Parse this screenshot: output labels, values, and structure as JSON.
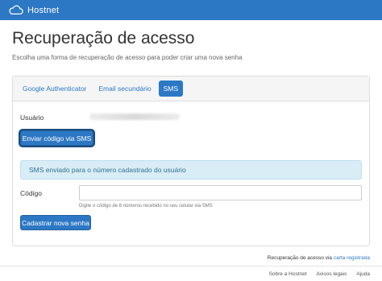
{
  "navbar": {
    "brand": "Hostnet"
  },
  "page": {
    "title": "Recuperação de acesso",
    "subtitle": "Escolha uma forma de recuperação de acesso para poder criar uma nova senha"
  },
  "tabs": [
    {
      "label": "Google Authenticator",
      "active": false
    },
    {
      "label": "Email secundário",
      "active": false
    },
    {
      "label": "SMS",
      "active": true
    }
  ],
  "form": {
    "user_label": "Usuário",
    "send_sms_button": "Enviar código via SMS",
    "alert_text": "SMS enviado para o número cadastrado do usuário",
    "code_label": "Código",
    "code_value": "",
    "code_help": "Digite o código de 6 números recebido no seu celular via SMS",
    "submit_button": "Cadastrar nova senha"
  },
  "recovery_note": {
    "text": "Recuperação de acesso via",
    "link": "carta registrada"
  },
  "footer": {
    "links": [
      "Sobre a Hostnet",
      "Avisos legais",
      "Ajuda"
    ]
  },
  "colors": {
    "brand_blue": "#2c78c5",
    "alert_bg": "#d9edf7",
    "alert_text": "#31708f"
  }
}
